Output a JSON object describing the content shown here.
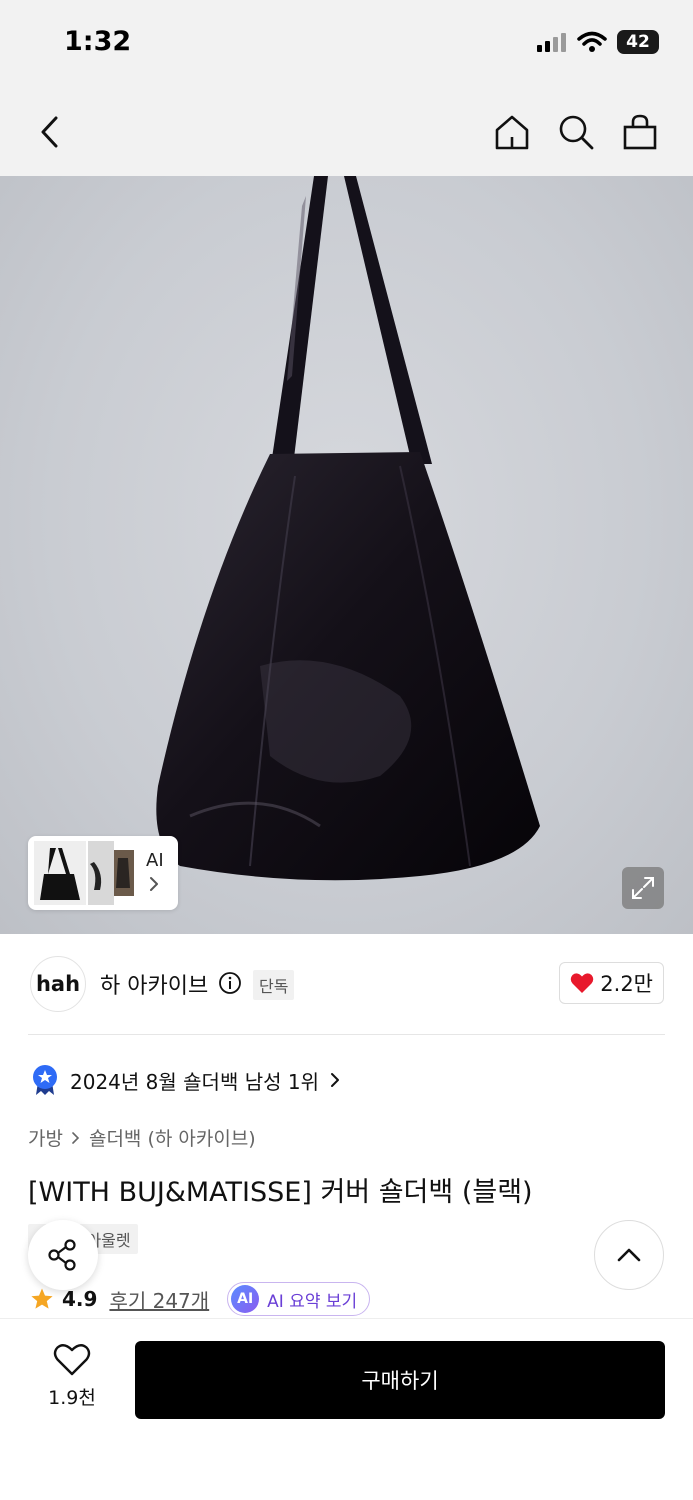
{
  "status_bar": {
    "time": "1:32",
    "battery": "42"
  },
  "nav": {
    "back_icon": "chevron-left-icon",
    "home_icon": "home-icon",
    "search_icon": "search-icon",
    "cart_icon": "shopping-bag-icon"
  },
  "gallery": {
    "thumbnail_ai_label": "AI"
  },
  "brand": {
    "logo_text": "hah",
    "name": "하 아카이브",
    "exclusive_badge": "단독",
    "likes": "2.2만"
  },
  "ranking": {
    "text": "2024년 8월 숄더백 남성 1위"
  },
  "breadcrumb": {
    "category": "가방",
    "subcategory": "숄더백 (하 아카이브)"
  },
  "product": {
    "title": "[WITH BUJ&MATISSE] 커버 숄더백 (블랙)",
    "tags": [
      "단독",
      "아울렛"
    ],
    "rating": "4.9",
    "reviews": "후기 247개",
    "ai_summary_badge": "AI",
    "ai_summary_label": "AI 요약 보기"
  },
  "bottom_bar": {
    "wishlist_count": "1.9천",
    "buy_label": "구매하기"
  },
  "colors": {
    "heart": "#e8192c",
    "star": "#f5a623",
    "buy_button": "#000000",
    "ai_accent": "#6a3fd6"
  }
}
